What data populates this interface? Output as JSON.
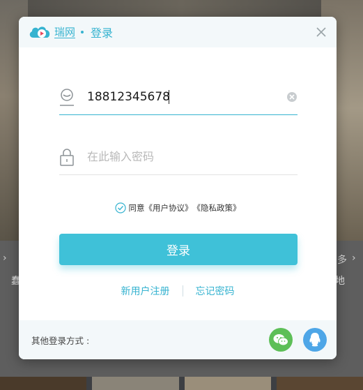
{
  "header": {
    "logo_text": "瑞网",
    "title": "登录"
  },
  "phone_field": {
    "value": "18812345678",
    "icon": "user-icon"
  },
  "password_field": {
    "placeholder": "在此输入密码",
    "icon": "lock-icon"
  },
  "agreement": {
    "prefix": "同意",
    "user_agreement": "《用户协议》",
    "privacy_policy": "《隐私政策》",
    "checked": true
  },
  "login_button": {
    "label": "登录"
  },
  "links": {
    "register": "新用户注册",
    "forgot_password": "忘记密码"
  },
  "footer": {
    "label": "其他登录方式 :",
    "social": [
      "wechat-icon",
      "qq-icon"
    ]
  },
  "background": {
    "left_char": "蠢",
    "right_char": "地",
    "right_more": "多"
  },
  "colors": {
    "accent": "#36b3d0",
    "button": "#3fc1d8",
    "wechat": "#5dbf57",
    "qq": "#4ea6e7"
  }
}
